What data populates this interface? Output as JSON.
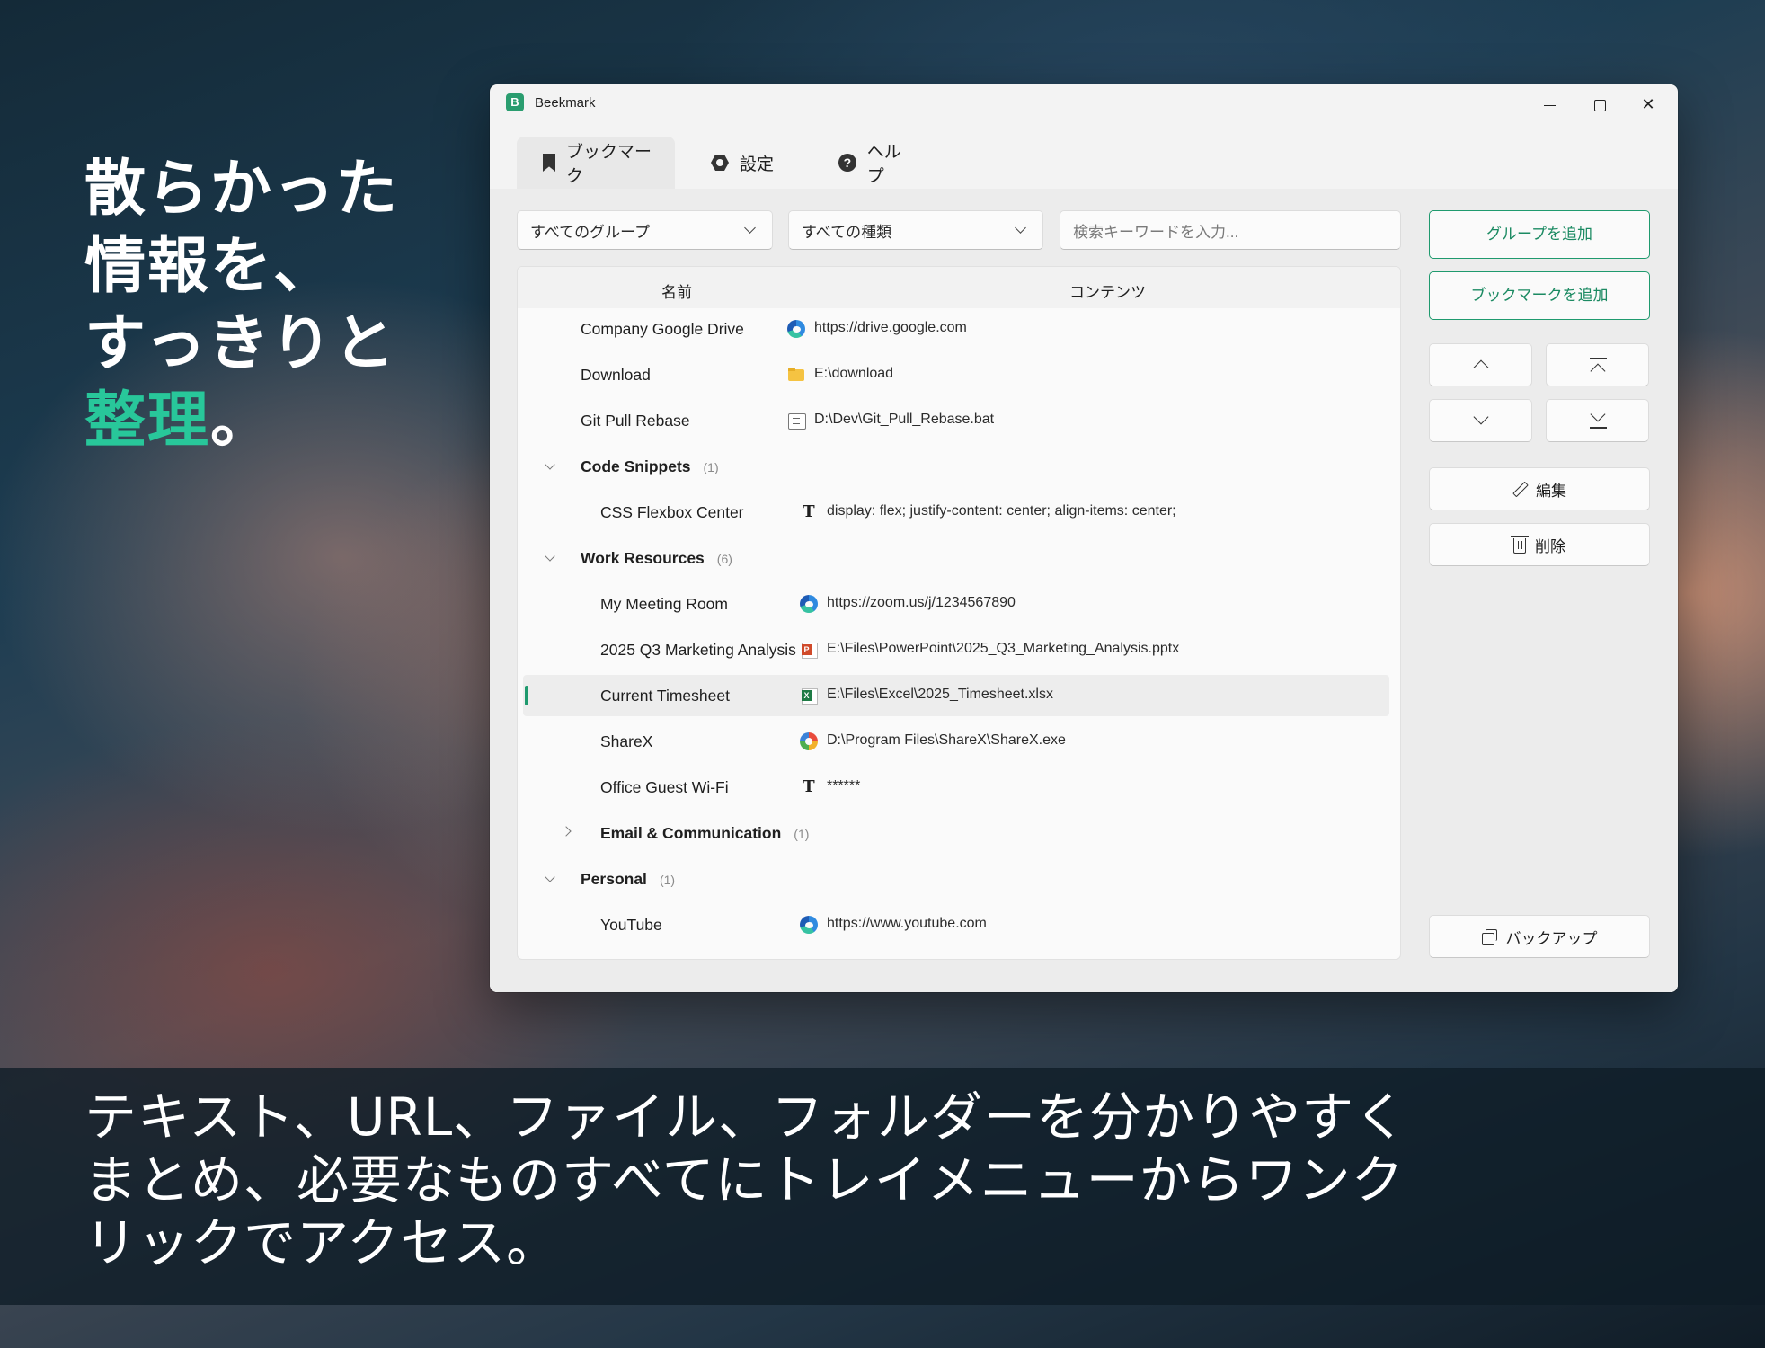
{
  "promo": {
    "headline_lines": [
      "散らかった",
      "情報を、",
      "すっきりと"
    ],
    "headline_accent": "整理",
    "headline_end": "。",
    "caption": "テキスト、URL、ファイル、フォルダーを分かりやすくまとめ、必要なものすべてにトレイメニューからワンクリックでアクセス。"
  },
  "colors": {
    "accent": "#1f9a6e",
    "headline_accent": "#28c79a"
  },
  "window": {
    "title": "Beekmark",
    "app_icon_letter": "B",
    "tabs": [
      {
        "label": "ブックマーク",
        "icon": "bookmark-icon",
        "active": true
      },
      {
        "label": "設定",
        "icon": "gear-icon",
        "active": false
      },
      {
        "label": "ヘルプ",
        "icon": "help-icon",
        "active": false
      }
    ]
  },
  "filters": {
    "group": "すべてのグループ",
    "type": "すべての種類",
    "search_placeholder": "検索キーワードを入力..."
  },
  "list": {
    "columns": {
      "name": "名前",
      "content": "コンテンツ"
    },
    "rows": [
      {
        "kind": "item",
        "name": "Company Google Drive",
        "icon": "edge-icon",
        "content": "https://drive.google.com"
      },
      {
        "kind": "item",
        "name": "Download",
        "icon": "folder-icon",
        "content": "E:\\download"
      },
      {
        "kind": "item",
        "name": "Git Pull Rebase",
        "icon": "bat-file-icon",
        "content": "D:\\Dev\\Git_Pull_Rebase.bat"
      },
      {
        "kind": "group",
        "name": "Code Snippets",
        "count": "(1)",
        "expanded": true
      },
      {
        "kind": "item",
        "name": "CSS Flexbox Center",
        "icon": "text-icon",
        "content": "display: flex; justify-content: center; align-items: center;"
      },
      {
        "kind": "group",
        "name": "Work Resources",
        "count": "(6)",
        "expanded": true
      },
      {
        "kind": "item",
        "name": "My Meeting Room",
        "icon": "edge-icon",
        "content": "https://zoom.us/j/1234567890"
      },
      {
        "kind": "item",
        "name": "2025 Q3 Marketing Analysis",
        "icon": "powerpoint-icon",
        "content": "E:\\Files\\PowerPoint\\2025_Q3_Marketing_Analysis.pptx"
      },
      {
        "kind": "item",
        "name": "Current Timesheet",
        "icon": "excel-icon",
        "content": "E:\\Files\\Excel\\2025_Timesheet.xlsx",
        "selected": true
      },
      {
        "kind": "item",
        "name": "ShareX",
        "icon": "sharex-icon",
        "content": "D:\\Program Files\\ShareX\\ShareX.exe"
      },
      {
        "kind": "item",
        "name": "Office Guest Wi-Fi",
        "icon": "text-icon",
        "content": "******"
      },
      {
        "kind": "group",
        "name": "Email & Communication",
        "count": "(1)",
        "expanded": false
      },
      {
        "kind": "group",
        "name": "Personal",
        "count": "(1)",
        "expanded": true
      },
      {
        "kind": "item",
        "name": "YouTube",
        "icon": "edge-icon",
        "content": "https://www.youtube.com"
      }
    ]
  },
  "side": {
    "add_group": "グループを追加",
    "add_bookmark": "ブックマークを追加",
    "edit": "編集",
    "delete": "削除",
    "backup": "バックアップ"
  }
}
